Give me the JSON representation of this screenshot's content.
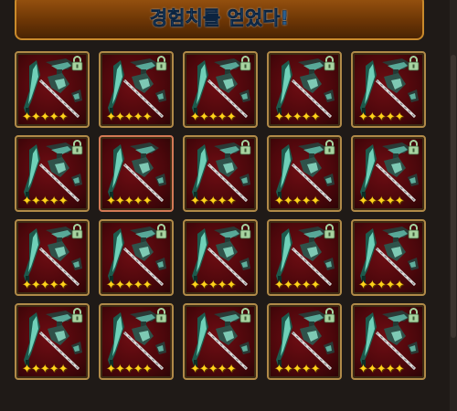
{
  "banner": {
    "text": "경험치를 얻었다!"
  },
  "grid": {
    "rows": 4,
    "cols": 5,
    "items": [
      {
        "stars": "✦✦✦✦✦",
        "locked": true,
        "highlight": false
      },
      {
        "stars": "✦✦✦✦✦",
        "locked": true,
        "highlight": false
      },
      {
        "stars": "✦✦✦✦✦",
        "locked": true,
        "highlight": false
      },
      {
        "stars": "✦✦✦✦✦",
        "locked": true,
        "highlight": false
      },
      {
        "stars": "✦✦✦✦✦",
        "locked": true,
        "highlight": false
      },
      {
        "stars": "✦✦✦✦✦",
        "locked": true,
        "highlight": false
      },
      {
        "stars": "✦✦✦✦✦",
        "locked": false,
        "highlight": true
      },
      {
        "stars": "✦✦✦✦✦",
        "locked": true,
        "highlight": false
      },
      {
        "stars": "✦✦✦✦✦",
        "locked": true,
        "highlight": false
      },
      {
        "stars": "✦✦✦✦✦",
        "locked": true,
        "highlight": false
      },
      {
        "stars": "✦✦✦✦✦",
        "locked": true,
        "highlight": false
      },
      {
        "stars": "✦✦✦✦✦",
        "locked": true,
        "highlight": false
      },
      {
        "stars": "✦✦✦✦✦",
        "locked": true,
        "highlight": false
      },
      {
        "stars": "✦✦✦✦✦",
        "locked": true,
        "highlight": false
      },
      {
        "stars": "✦✦✦✦✦",
        "locked": true,
        "highlight": false
      },
      {
        "stars": "✦✦✦✦✦",
        "locked": true,
        "highlight": false
      },
      {
        "stars": "✦✦✦✦✦",
        "locked": true,
        "highlight": false
      },
      {
        "stars": "✦✦✦✦✦",
        "locked": true,
        "highlight": false
      },
      {
        "stars": "✦✦✦✦✦",
        "locked": true,
        "highlight": false
      },
      {
        "stars": "✦✦✦✦✦",
        "locked": true,
        "highlight": false
      }
    ]
  },
  "icons": {
    "weapon": "weapon-scythe-icon",
    "lock": "lock-icon",
    "star": "star-icon"
  },
  "colors": {
    "banner_bg": "#8a4a0c",
    "banner_text": "#2c5f8d",
    "slot_bg": "#6e0d13",
    "slot_border": "#b08a48",
    "slot_highlight_border": "#d37a55",
    "star": "#ffd21a",
    "lock": "#a7d3a0"
  }
}
